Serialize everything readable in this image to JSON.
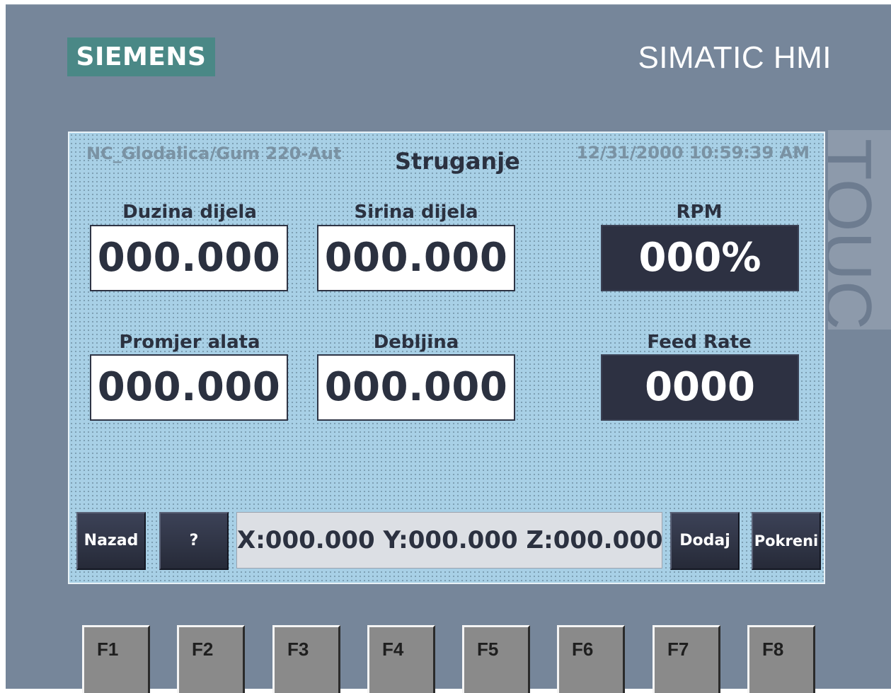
{
  "device": {
    "brand": "SIEMENS",
    "product": "SIMATIC HMI",
    "touch_label": "TOUCH"
  },
  "screen": {
    "path": "NC_Glodalica/Gum 220-Aut",
    "title": "Struganje",
    "datetime": "12/31/2000 10:59:39 AM"
  },
  "fields": {
    "duzina": {
      "label": "Duzina dijela",
      "value": "000.000"
    },
    "sirina": {
      "label": "Sirina dijela",
      "value": "000.000"
    },
    "rpm": {
      "label": "RPM",
      "value": "000%"
    },
    "promjer": {
      "label": "Promjer alata",
      "value": "000.000"
    },
    "debljina": {
      "label": "Debljina",
      "value": "000.000"
    },
    "feed_rate": {
      "label": "Feed Rate",
      "value": "0000"
    }
  },
  "buttons": {
    "back": "Nazad",
    "help": "?",
    "add": "Dodaj",
    "start": "Pokreni"
  },
  "coordinates": "X:000.000 Y:000.000 Z:000.000",
  "function_keys": [
    "F1",
    "F2",
    "F3",
    "F4",
    "F5",
    "F6",
    "F7",
    "F8"
  ],
  "colors": {
    "bezel": "#76869a",
    "screen_bg": "#a8d0e6",
    "brand_bg": "#4a8886",
    "dark_display": "#2d3142"
  }
}
